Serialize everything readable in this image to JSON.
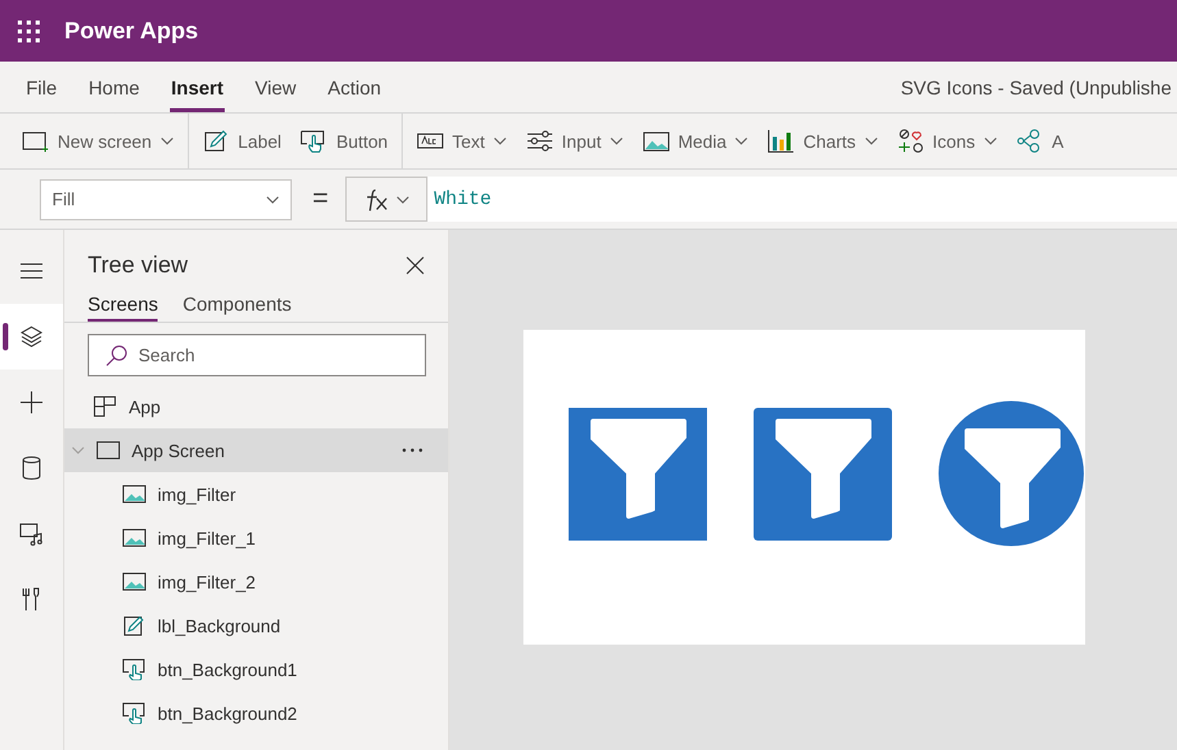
{
  "app_bar": {
    "title": "Power Apps"
  },
  "menu": [
    {
      "label": "File",
      "selected": false
    },
    {
      "label": "Home",
      "selected": false
    },
    {
      "label": "Insert",
      "selected": true
    },
    {
      "label": "View",
      "selected": false
    },
    {
      "label": "Action",
      "selected": false
    }
  ],
  "document_title": "SVG Icons - Saved (Unpublishe",
  "toolbar": [
    {
      "kind": "screen",
      "label": "New screen",
      "dropdown": true,
      "divider": true
    },
    {
      "kind": "label",
      "label": "Label",
      "dropdown": false,
      "divider": false
    },
    {
      "kind": "button",
      "label": "Button",
      "dropdown": false,
      "divider": true
    },
    {
      "kind": "text",
      "label": "Text",
      "dropdown": true,
      "divider": false
    },
    {
      "kind": "input",
      "label": "Input",
      "dropdown": true,
      "divider": false
    },
    {
      "kind": "media",
      "label": "Media",
      "dropdown": true,
      "divider": false
    },
    {
      "kind": "charts",
      "label": "Charts",
      "dropdown": true,
      "divider": false
    },
    {
      "kind": "icons",
      "label": "Icons",
      "dropdown": true,
      "divider": false
    },
    {
      "kind": "ai",
      "label": "A",
      "dropdown": false,
      "divider": false
    }
  ],
  "formula_bar": {
    "property": "Fill",
    "operator": "=",
    "formula": "White"
  },
  "rail": [
    {
      "kind": "menu",
      "selected": false
    },
    {
      "kind": "layers",
      "selected": true
    },
    {
      "kind": "plus",
      "selected": false
    },
    {
      "kind": "data",
      "selected": false
    },
    {
      "kind": "media",
      "selected": false
    },
    {
      "kind": "tools",
      "selected": false
    }
  ],
  "tree_view": {
    "title": "Tree view",
    "tabs": [
      {
        "label": "Screens",
        "selected": true
      },
      {
        "label": "Components",
        "selected": false
      }
    ],
    "search": {
      "placeholder": "Search"
    },
    "items": [
      {
        "kind": "app",
        "label": "App",
        "selected": false
      },
      {
        "kind": "screen",
        "label": "App Screen",
        "selected": true,
        "expanded": true,
        "children": [
          {
            "kind": "image",
            "label": "img_Filter",
            "selected": false
          },
          {
            "kind": "image",
            "label": "img_Filter_1",
            "selected": false
          },
          {
            "kind": "image",
            "label": "img_Filter_2",
            "selected": false
          },
          {
            "kind": "label",
            "label": "lbl_Background",
            "selected": false
          },
          {
            "kind": "button",
            "label": "btn_Background1",
            "selected": false
          },
          {
            "kind": "button",
            "label": "btn_Background2",
            "selected": false
          }
        ]
      }
    ]
  },
  "canvas": {
    "images": [
      {
        "kind": "square"
      },
      {
        "kind": "rounded"
      },
      {
        "kind": "circle"
      }
    ]
  }
}
